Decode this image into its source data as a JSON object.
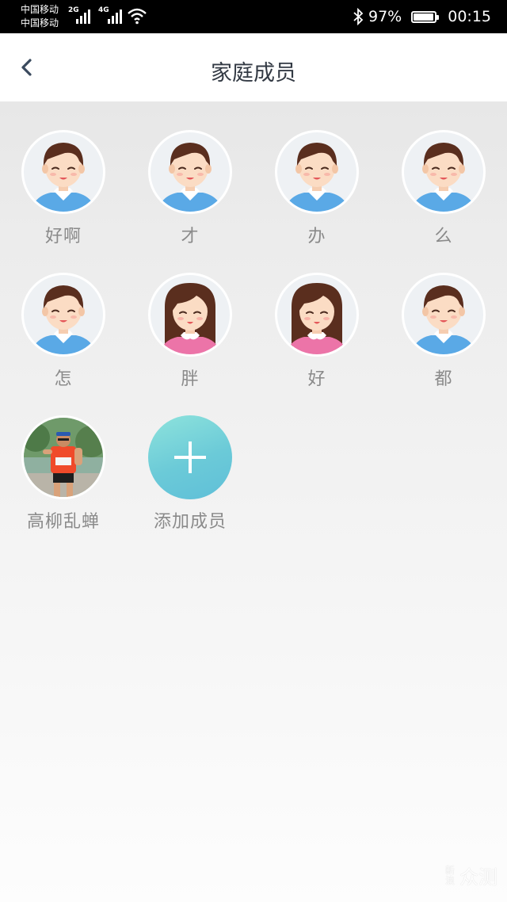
{
  "status_bar": {
    "carrier_1": "中国移动",
    "carrier_2": "中国移动",
    "network_1": "2G",
    "network_2": "4G",
    "battery": "97%",
    "time": "00:15"
  },
  "header": {
    "title": "家庭成员"
  },
  "members": [
    {
      "name": "好啊",
      "avatar": "boy-avatar-icon"
    },
    {
      "name": "才",
      "avatar": "boy-avatar-icon"
    },
    {
      "name": "办",
      "avatar": "boy-avatar-icon"
    },
    {
      "name": "么",
      "avatar": "boy-avatar-icon"
    },
    {
      "name": "怎",
      "avatar": "boy-avatar-icon"
    },
    {
      "name": "胖",
      "avatar": "girl-avatar-icon"
    },
    {
      "name": "好",
      "avatar": "girl-avatar-icon"
    },
    {
      "name": "都",
      "avatar": "boy-avatar-icon"
    },
    {
      "name": "高柳乱蝉",
      "avatar": "runner-photo"
    }
  ],
  "add_member": {
    "label": "添加成员"
  },
  "watermark": {
    "logo": "新浪",
    "text": "众测"
  },
  "colors": {
    "accent_gradient_start": "#8ee3dc",
    "accent_gradient_end": "#5fbfd8",
    "boy_shirt": "#5aa9e6",
    "girl_shirt": "#ec74a8",
    "hair": "#5a2e1e"
  }
}
